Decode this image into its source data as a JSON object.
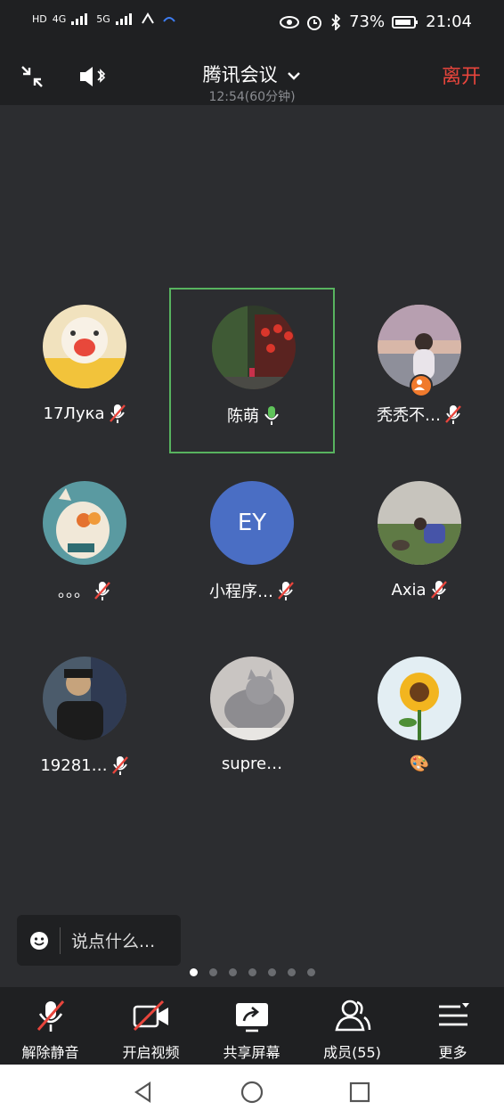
{
  "status": {
    "left_labels": [
      "HD",
      "4G",
      "5G"
    ],
    "battery": "73%",
    "time": "21:04"
  },
  "header": {
    "title": "腾讯会议",
    "subtitle": "12:54(60分钟)",
    "leave": "离开"
  },
  "participants": [
    {
      "name": "17Лука",
      "mic": "muted"
    },
    {
      "name": "陈萌",
      "mic": "speaking"
    },
    {
      "name": "秃秃不…",
      "mic": "muted"
    },
    {
      "name": "。。。",
      "mic": "muted"
    },
    {
      "name": "小程序…",
      "mic": "muted",
      "initials": "EY"
    },
    {
      "name": "Axia",
      "mic": "muted"
    },
    {
      "name": "19281…",
      "mic": "muted"
    },
    {
      "name": "supre…",
      "mic": "none"
    },
    {
      "name": "🎨",
      "mic": "none"
    }
  ],
  "chat": {
    "placeholder": "说点什么..."
  },
  "pager": {
    "total": 7,
    "current": 1
  },
  "toolbar": {
    "unmute": "解除静音",
    "video": "开启视频",
    "share": "共享屏幕",
    "members": "成员(55)",
    "more": "更多"
  }
}
